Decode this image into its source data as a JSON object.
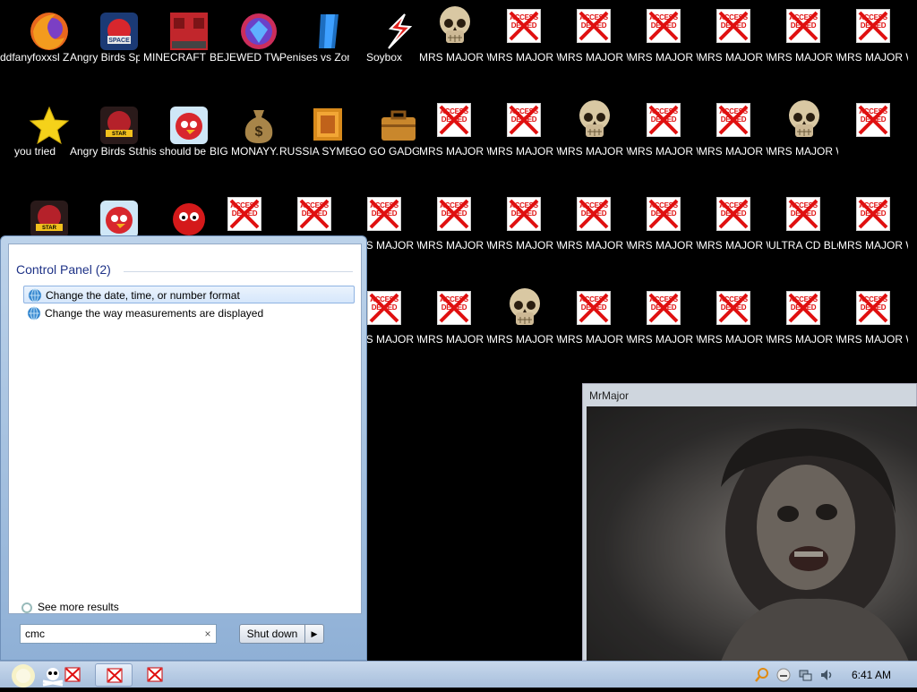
{
  "desktop": {
    "icons": [
      {
        "label": "ddfanyfoxxsl ZUCLEANER G",
        "kind": "firefox"
      },
      {
        "label": "Angry Birds Space",
        "kind": "angry-space"
      },
      {
        "label": "MINECRAFT",
        "kind": "minecraft"
      },
      {
        "label": "BEJEWED TWIST...",
        "kind": "bejeweled"
      },
      {
        "label": "Penises vs Zombococks",
        "kind": "pvz"
      },
      {
        "label": "Soybox",
        "kind": "soybox"
      },
      {
        "label": "MRS MAJOR WANTS TO...",
        "kind": "skull"
      },
      {
        "label": "MRS MAJOR WANTS TO...",
        "kind": "denied"
      },
      {
        "label": "MRS MAJOR WANTS TO...",
        "kind": "denied"
      },
      {
        "label": "MRS MAJOR WANTS TO...",
        "kind": "denied"
      },
      {
        "label": "MRS MAJOR WANTS TO...",
        "kind": "denied"
      },
      {
        "label": "MRS MAJOR WANTS TO...",
        "kind": "denied"
      },
      {
        "label": "MRS MAJOR WANTS TO...",
        "kind": "denied"
      },
      {
        "label": "you tried",
        "kind": "star"
      },
      {
        "label": "Angry Birds Star Wars II",
        "kind": "angry-starwars"
      },
      {
        "label": "this should be on vinesauc...",
        "kind": "angry-red"
      },
      {
        "label": "BIG MONAYY...",
        "kind": "moneybag"
      },
      {
        "label": "RUSSIA SYMBOL",
        "kind": "russia"
      },
      {
        "label": "GO GO GADGET ...",
        "kind": "briefcase"
      },
      {
        "label": "MRS MAJOR WANTS TO...",
        "kind": "denied"
      },
      {
        "label": "MRS MAJOR WANTS TO...",
        "kind": "denied"
      },
      {
        "label": "MRS MAJOR WANTS TO...",
        "kind": "skull"
      },
      {
        "label": "MRS MAJOR WANTS TO...",
        "kind": "denied"
      },
      {
        "label": "MRS MAJOR WANTS TO...",
        "kind": "denied"
      },
      {
        "label": "MRS MAJOR WANTS TO...",
        "kind": "skull"
      },
      {
        "label": "",
        "kind": "denied"
      },
      {
        "label": "",
        "kind": "angry-starwars"
      },
      {
        "label": "",
        "kind": "angry-red"
      },
      {
        "label": "",
        "kind": "fuzzy"
      },
      {
        "label": "",
        "kind": "denied"
      },
      {
        "label": "MRS MAJOR WANTS TO...",
        "kind": "denied"
      },
      {
        "label": "MRS MAJOR WANTS TO...",
        "kind": "denied"
      },
      {
        "label": "MRS MAJOR WANTS TO...",
        "kind": "denied"
      },
      {
        "label": "MRS MAJOR WANTS TO...",
        "kind": "denied"
      },
      {
        "label": "MRS MAJOR WANTS TO...",
        "kind": "denied"
      },
      {
        "label": "MRS MAJOR WANTS TO...",
        "kind": "denied"
      },
      {
        "label": "MRS MAJOR WANTS TO...",
        "kind": "denied"
      },
      {
        "label": "ULTRA CD BLOATWAR...",
        "kind": "denied"
      },
      {
        "label": "MRS MAJOR WANTS TO...",
        "kind": "denied"
      },
      {
        "label": "MRS MAJOR WANTS TO...",
        "kind": "denied"
      },
      {
        "label": "MRS MAJOR WANTS TO...",
        "kind": "denied"
      },
      {
        "label": "MRS MAJOR WANTS TO...",
        "kind": "denied"
      },
      {
        "label": "MRS MAJOR WANTS TO...",
        "kind": "denied"
      },
      {
        "label": "MRS MAJOR WANTS TO...",
        "kind": "denied"
      },
      {
        "label": "MRS MAJOR WANTS TO...",
        "kind": "denied"
      },
      {
        "label": "MRS MAJOR WANTS TO...",
        "kind": "denied"
      },
      {
        "label": "MRS MAJOR WANTS TO...",
        "kind": "skull"
      },
      {
        "label": "MRS MAJOR WANTS TO...",
        "kind": "denied"
      },
      {
        "label": "MRS MAJOR WANTS TO...",
        "kind": "denied"
      },
      {
        "label": "MRS MAJOR WANTS TO...",
        "kind": "denied"
      },
      {
        "label": "MRS MAJOR WANTS TO...",
        "kind": "denied"
      },
      {
        "label": "MRS MAJOR WANTS TO...",
        "kind": "denied"
      },
      {
        "label": "MRS MAJOR WANTS TO...",
        "kind": "denied"
      },
      {
        "label": "MRS MAJOR WANTS TO...",
        "kind": "denied"
      },
      {
        "label": "MRS MAJOR WANTS TO...",
        "kind": "denied"
      },
      {
        "label": "MRS MAJOR WANTS TO...",
        "kind": "denied"
      }
    ],
    "access_denied_text": "ACCESS DENIED"
  },
  "start_menu": {
    "section_title": "Control Panel (2)",
    "results": [
      {
        "label": "Change the date, time, or number format",
        "selected": true
      },
      {
        "label": "Change the way measurements are displayed",
        "selected": false
      }
    ],
    "see_more": "See more results",
    "search_value": "cmc",
    "search_clear": "×",
    "shutdown_label": "Shut down",
    "shutdown_arrow": "▶"
  },
  "window": {
    "title": "MrMajor"
  },
  "taskbar": {
    "clock": "6:41 AM"
  },
  "colors": {
    "denied_red": "#e01010",
    "start_menu_blue": "#1e3287",
    "desktop_bg": "#000000"
  }
}
